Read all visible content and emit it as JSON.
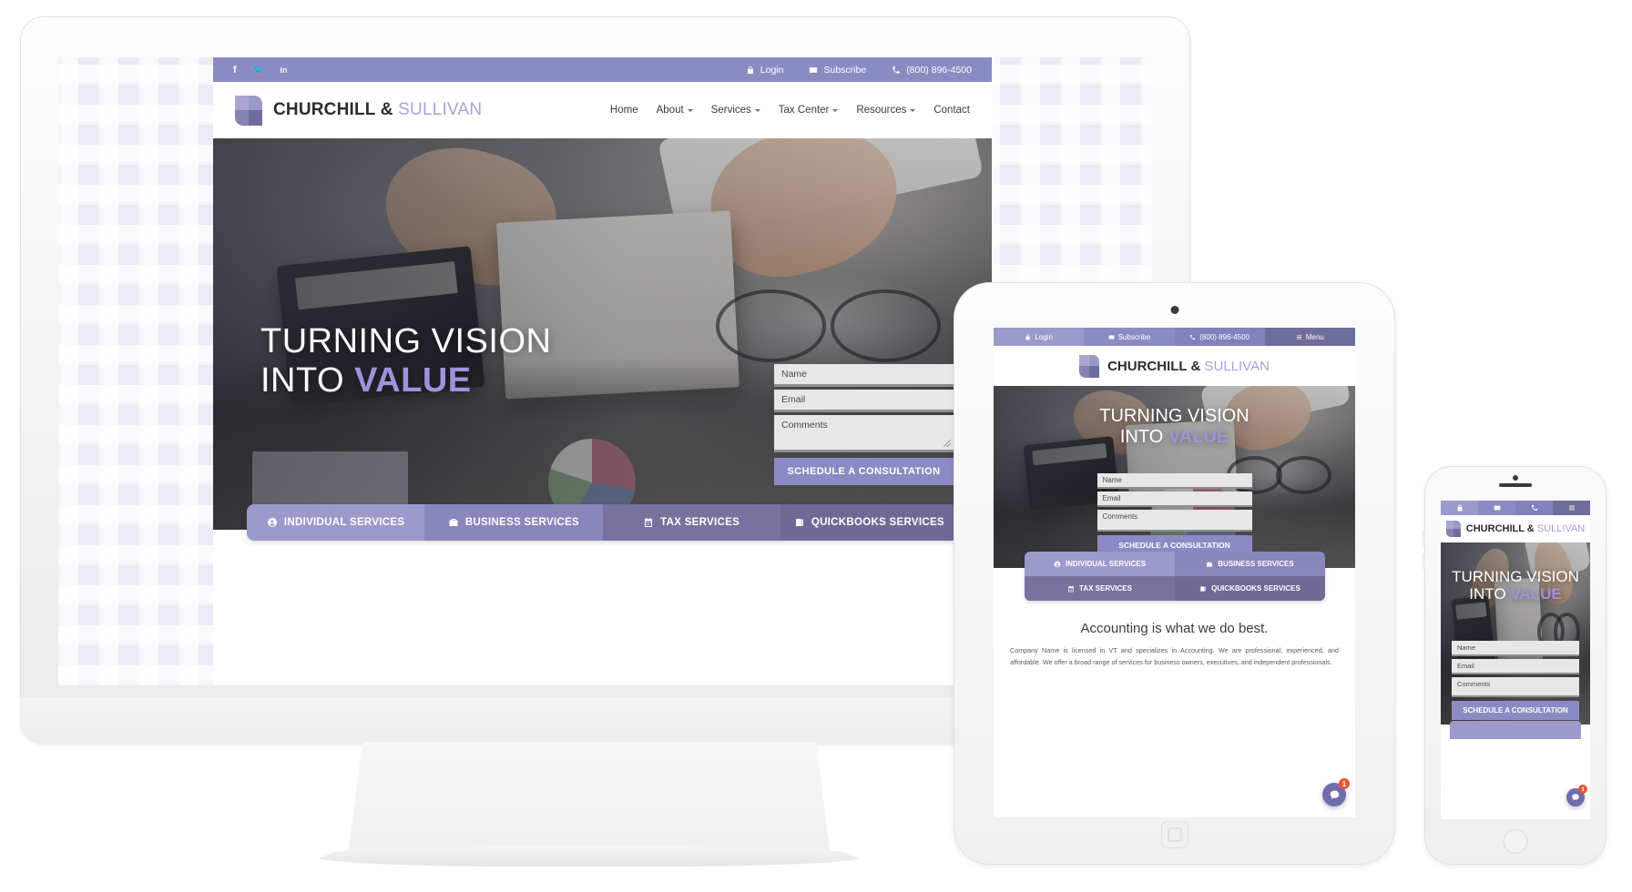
{
  "site": {
    "topbar": {
      "social": [
        {
          "name": "facebook-icon",
          "glyph": "f"
        },
        {
          "name": "twitter-icon",
          "glyph": "🐦"
        },
        {
          "name": "linkedin-icon",
          "glyph": "in"
        }
      ],
      "login": "Login",
      "subscribe": "Subscribe",
      "phone": "(800) 896-4500",
      "menu": "Menu"
    },
    "brand": {
      "part1": "CHURCHILL &",
      "part2": "SULLIVAN"
    },
    "nav": [
      {
        "label": "Home",
        "caret": false
      },
      {
        "label": "About",
        "caret": true
      },
      {
        "label": "Services",
        "caret": true
      },
      {
        "label": "Tax Center",
        "caret": true
      },
      {
        "label": "Resources",
        "caret": true
      },
      {
        "label": "Contact",
        "caret": false
      }
    ],
    "hero": {
      "line1": "TURNING VISION",
      "line2_pre": "INTO ",
      "line2_accent": "VALUE"
    },
    "form": {
      "name_placeholder": "Name",
      "email_placeholder": "Email",
      "comments_placeholder": "Comments",
      "submit_label": "SCHEDULE A CONSULTATION"
    },
    "services": [
      {
        "label": "INDIVIDUAL SERVICES",
        "icon": "user-circle-icon"
      },
      {
        "label": "BUSINESS SERVICES",
        "icon": "briefcase-icon"
      },
      {
        "label": "TAX SERVICES",
        "icon": "calendar-icon"
      },
      {
        "label": "QUICKBOOKS SERVICES",
        "icon": "book-icon"
      }
    ],
    "content": {
      "heading": "Accounting is what we do best.",
      "paragraph": "Company Name is licensed in VT and specializes in Accounting. We are professional, experienced, and affordable. We offer a broad range of services for business owners, executives, and independent professionals."
    },
    "chat": {
      "badge": "1",
      "icon": "chat-bubble-icon"
    }
  },
  "colors": {
    "brand_purple": "#8b8bc4",
    "brand_purple_light": "#9b9acb",
    "brand_purple_dark": "#6d6b96",
    "accent_text": "#9d93da",
    "badge_red": "#e8542f"
  }
}
